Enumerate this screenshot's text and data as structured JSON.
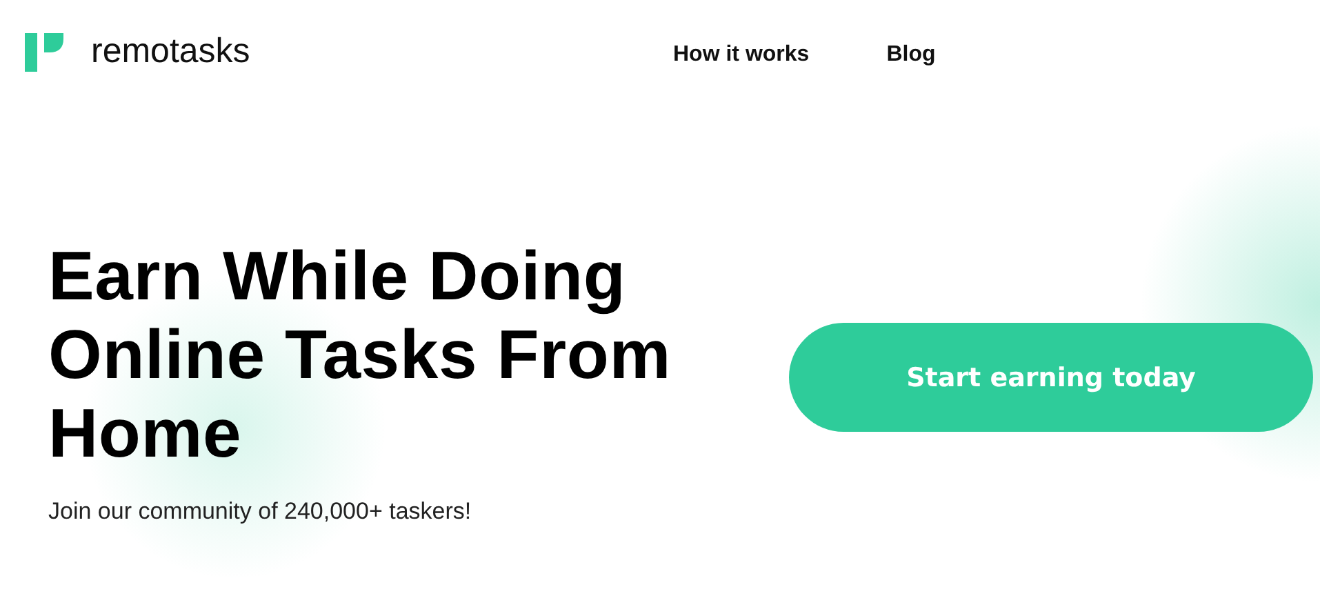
{
  "header": {
    "logo_text": "remotasks",
    "nav": [
      {
        "label": "How it works"
      },
      {
        "label": "Blog"
      }
    ]
  },
  "hero": {
    "title": "Earn While Doing Online Tasks From Home",
    "subtitle": "Join our community of 240,000+ taskers!",
    "cta": "Start earning today"
  }
}
